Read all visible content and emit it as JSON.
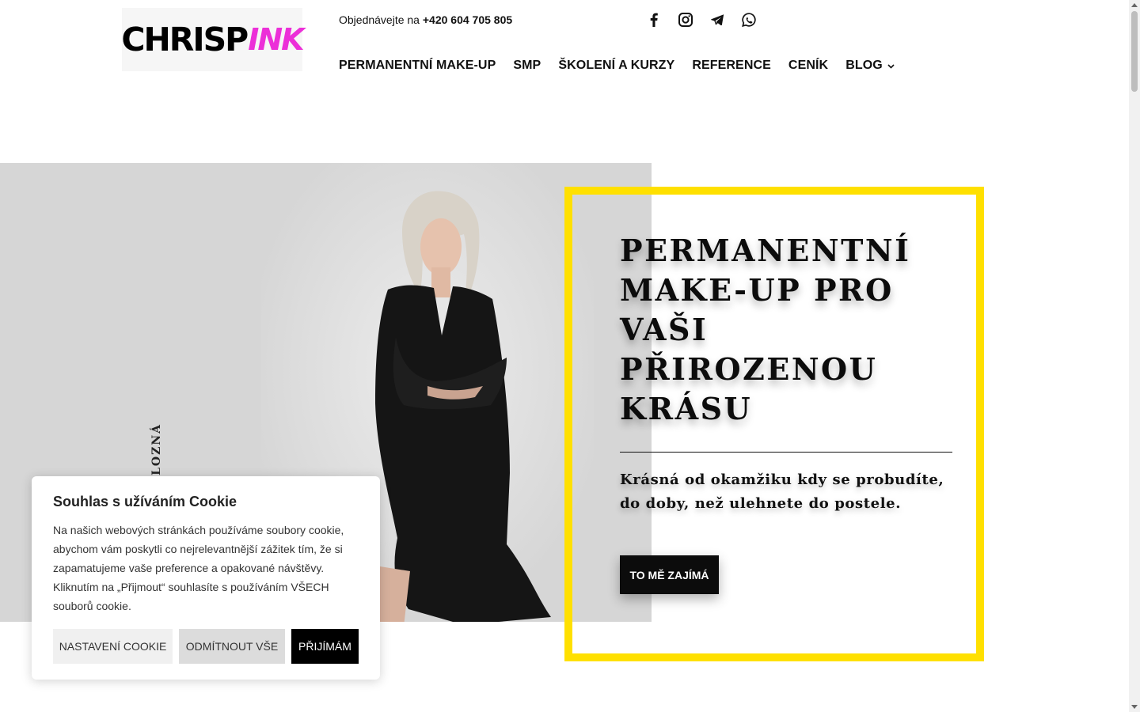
{
  "header": {
    "logo_text_main": "CHRISP",
    "logo_text_accent": "INK",
    "phone_prefix": "Objednávejte na",
    "phone_number": "+420 604 705 805",
    "social_icons": [
      "facebook-icon",
      "instagram-icon",
      "telegram-icon",
      "whatsapp-icon"
    ]
  },
  "nav": {
    "items": [
      {
        "label": "PERMANENTNÍ MAKE-UP"
      },
      {
        "label": "SMP"
      },
      {
        "label": "ŠKOLENÍ A KURZY"
      },
      {
        "label": "REFERENCE"
      },
      {
        "label": "CENÍK"
      },
      {
        "label": "BLOG"
      }
    ]
  },
  "hero": {
    "side_text": "LOZNÁ",
    "headline_lines": [
      "PERMANENTNÍ",
      "MAKE-UP PRO",
      "VAŠI",
      "PŘIROZENOU",
      "KRÁSU"
    ],
    "subtext": "Krásná od okamžiku kdy se probudíte, do doby, než ulehnete do postele.",
    "cta_label": "TO MĚ ZAJÍMÁ"
  },
  "cookie": {
    "title": "Souhlas s užíváním Cookie",
    "text": "Na našich webových stránkách používáme soubory cookie, abychom vám poskytli co nejrelevantnější zážitek tím, že si zapamatujeme vaše preference a opakované návštěvy. Kliknutím na „Přijmout“ souhlasíte s používáním VŠECH souborů cookie.",
    "btn_settings": "NASTAVENÍ COOKIE",
    "btn_reject": "ODMÍTNOUT VŠE",
    "btn_accept": "PŘIJÍMÁM"
  },
  "colors": {
    "accent_yellow": "#ffe000",
    "brand_pink": "#ec2fd8",
    "dark": "#0c0c0c"
  }
}
